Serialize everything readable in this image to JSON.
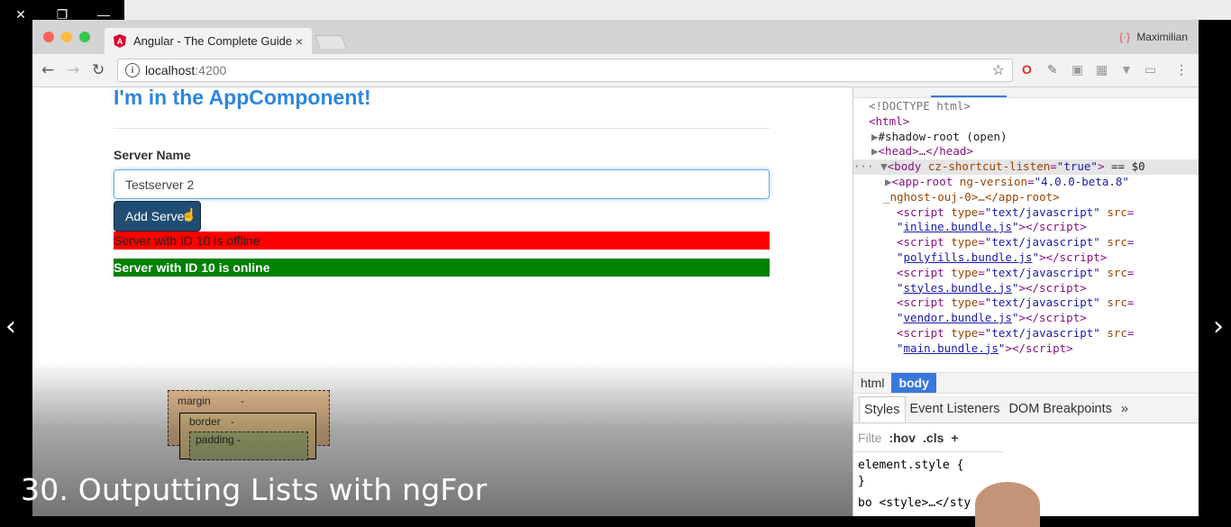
{
  "player": {
    "close_icon": "✕",
    "restore_icon": "❐",
    "minimize_icon": "—",
    "prev_icon": "‹",
    "next_icon": "›",
    "lesson_title": "30. Outputting Lists with ngFor"
  },
  "browser": {
    "tab_title": "Angular - The Complete Guide",
    "tab_close": "×",
    "profile_name": "Maximilian",
    "url_host": "localhost",
    "url_port": ":4200",
    "traffic_colors": [
      "#fc605c",
      "#fcbb40",
      "#34c84a"
    ]
  },
  "app": {
    "heading": "I'm in the AppComponent!",
    "server_name_label": "Server Name",
    "server_name_value": "Testserver 2",
    "add_button": "Add Server",
    "offline_msg": "Server with ID 10 is offline",
    "online_msg": "Server with ID 10 is online"
  },
  "devtools": {
    "dom": {
      "doctype": "<!DOCTYPE html>",
      "html_open": "<html>",
      "shadow_root": "#shadow-root (open)",
      "head": "<head>…</head>",
      "body_attr": "cz-shortcut-listen",
      "body_val": "\"true\"",
      "body_suffix": "== $0",
      "app_root_version": "\"4.0.0-beta.8\"",
      "app_root_rest": "_nghost-ouj-0>…</app-root>",
      "scripts": [
        "inline.bundle.js",
        "polyfills.bundle.js",
        "styles.bundle.js",
        "vendor.bundle.js",
        "main.bundle.js"
      ]
    },
    "breadcrumbs": [
      "html",
      "body"
    ],
    "subtabs": [
      "Styles",
      "Event Listeners",
      "DOM Breakpoints",
      "»"
    ],
    "filter_placeholder": "Filte",
    "hov": ":hov",
    "cls": ".cls",
    "plus": "+",
    "element_style": "element.style {",
    "close_brace": "}",
    "style_rule": "bo <style>…</sty",
    "box_margin": "margin",
    "box_border": "border",
    "box_padding": "padding -",
    "dash": "-"
  }
}
